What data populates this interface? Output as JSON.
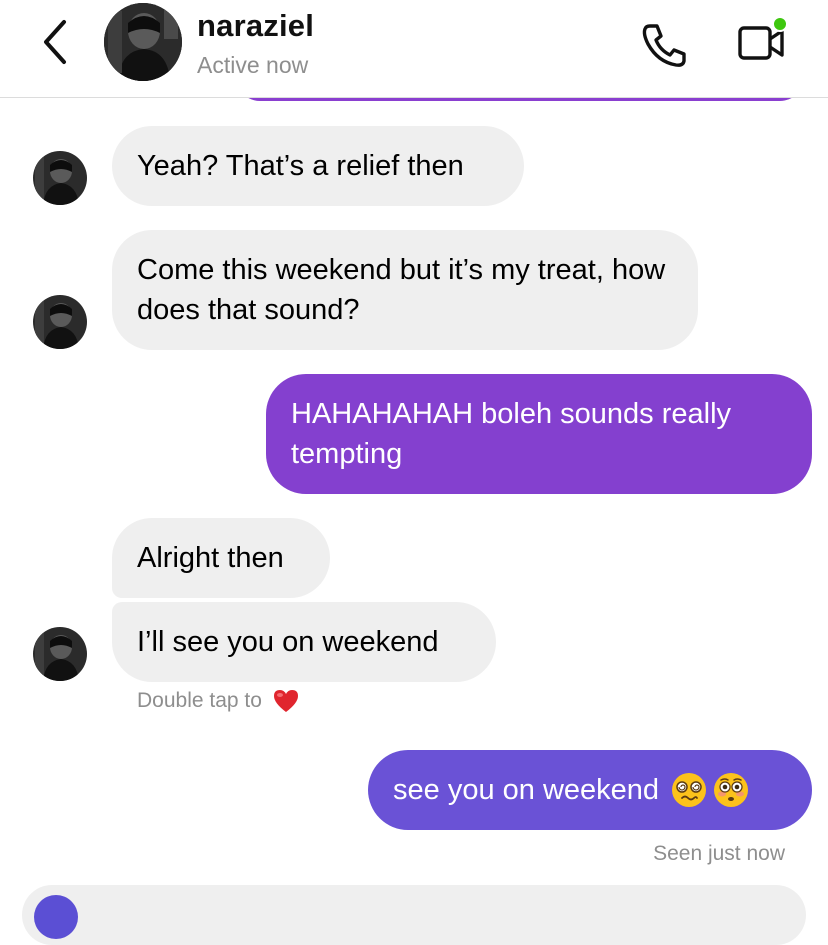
{
  "header": {
    "username": "naraziel",
    "status": "Active now",
    "back_icon": "chevron-left-icon",
    "call_icon": "phone-icon",
    "video_icon": "video-camera-icon",
    "online_color": "#3ec70f"
  },
  "colors": {
    "incoming_bubble": "#efefef",
    "outgoing_purple": "#8440cf",
    "outgoing_indigo": "#6a52d6",
    "meta_text": "#8e8e8e"
  },
  "messages": [
    {
      "sender": "them",
      "text": "Yeah? That’s a relief then"
    },
    {
      "sender": "them",
      "text": "Come this weekend but it’s my treat, how does that sound?"
    },
    {
      "sender": "me",
      "text": "HAHAHAHAH boleh sounds really tempting"
    },
    {
      "sender": "them",
      "text": "Alright then"
    },
    {
      "sender": "them",
      "text": "I’ll see you on weekend"
    },
    {
      "sender": "me",
      "text": "see you on weekend",
      "emojis": [
        "dizzy-face-icon",
        "flushed-face-icon"
      ]
    }
  ],
  "reaction_hint": {
    "text": "Double tap to",
    "icon": "red-heart-icon"
  },
  "seen_text": "Seen just now"
}
